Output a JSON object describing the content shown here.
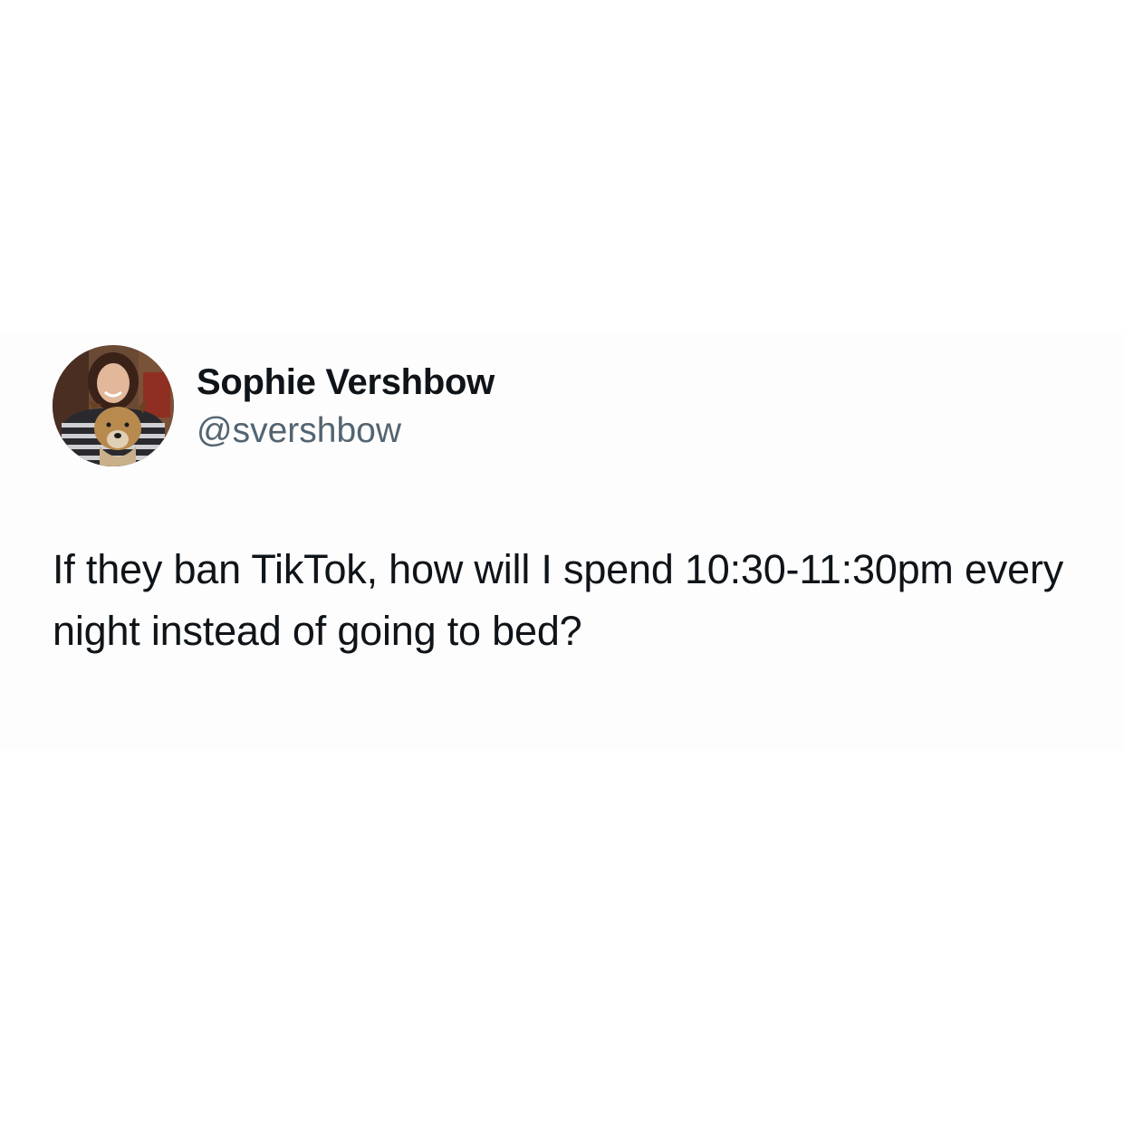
{
  "tweet": {
    "author": {
      "display_name": "Sophie Vershbow",
      "handle": "@svershbow",
      "avatar_icon": "profile-photo-with-dog"
    },
    "text": "If they ban TikTok, how will I spend 10:30-11:30pm every night instead of going to bed?"
  },
  "colors": {
    "background": "#ffffff",
    "name_text": "#0f1419",
    "handle_text": "#536471",
    "body_text": "#0f1419"
  }
}
